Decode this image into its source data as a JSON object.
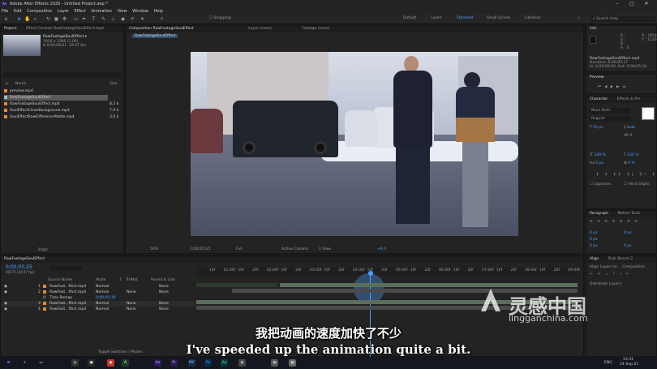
{
  "window": {
    "title": "Adobe After Effects 2020 - Untitled Project.aep *",
    "controls": [
      "–",
      "□",
      "✕"
    ]
  },
  "menu": [
    "File",
    "Edit",
    "Composition",
    "Layer",
    "Effect",
    "Animation",
    "View",
    "Window",
    "Help"
  ],
  "toolbar": {
    "snapping": "Snapping",
    "workspaces": [
      "Default",
      "Learn",
      "Standard",
      "Small Screen",
      "Libraries"
    ],
    "active_workspace": "Standard",
    "more": "»",
    "search_help": "Search Help"
  },
  "project_panel": {
    "tabs": [
      "Project",
      "Effect Controls RawFootageSoulEffect.mp4"
    ],
    "selected_name": "RawFootageSoulEffect ▾",
    "selected_info": [
      "1920 x 1080 (1.00)",
      "Δ 0;00;06;01, 29.97 fps"
    ],
    "search_placeholder": "ρ",
    "col_name": "Name",
    "col_size": "Size",
    "items": [
      {
        "name": "preview.mp4",
        "size": ""
      },
      {
        "name": "RawFootageSoulEffect",
        "size": ""
      },
      {
        "name": "RawFootageSoulEffect.mp4",
        "size": "8.2 k"
      },
      {
        "name": "SoulEffectCleanBackground.mp4",
        "size": "7.9 k"
      },
      {
        "name": "SoulEffectRawDifferenceMatte.mp4",
        "size": "3.0 k"
      }
    ],
    "bpc": "8 bpc"
  },
  "comp_panel": {
    "tabs": [
      "Composition RawFootageSoulEffect",
      "Layer (none)",
      "Footage (none)"
    ],
    "breadcrumb": "RawFootageSoulEffect",
    "footer": [
      "50%",
      "0;00;05;25",
      "Full",
      "Active Camera",
      "1 View",
      "+0.0"
    ]
  },
  "info_panel": {
    "title": "Info",
    "values": [
      "R :",
      "G :",
      "B :",
      "A : 0",
      "X : 1954",
      "Y : 1120"
    ],
    "file": "RawFootageSoulEffect.mp4",
    "lines": [
      "Duration: 0;00;05;17",
      "In: 0;00;00;00, Out: 0;00;05;16"
    ]
  },
  "preview_panel": {
    "title": "Preview"
  },
  "character_panel": {
    "tabs": [
      "Character",
      "Effects & Pre"
    ],
    "font": "Nexa Bold",
    "style": "Regular",
    "size": "55 px",
    "leading": "Auto",
    "tracking": "0",
    "scale_v": "100 %",
    "scale_h": "100 %",
    "baseline": "0 px",
    "tsume": "0 %",
    "ligatures": "Ligatures",
    "hindi": "Hindi Digits"
  },
  "paragraph_panel": {
    "tabs": [
      "Paragraph",
      "Motion Tools"
    ],
    "values": [
      "0 px",
      "0 px",
      "0 px",
      "0 px",
      "0 px"
    ]
  },
  "align_panel": {
    "tabs": [
      "Align",
      "Duik Bassel.2"
    ],
    "align_to": "Align Layers to:",
    "align_target": "Composition",
    "distribute": "Distribute Layers:"
  },
  "timeline": {
    "tab": "RawFootageSoulEffect",
    "timecode": "0;00;05;25",
    "timecode_sub": "00175 (29.97 fps)",
    "columns": [
      "Source Name",
      "Mode",
      "T",
      "TrkMat",
      "Parent & Link"
    ],
    "layers": [
      {
        "num": "1",
        "name": "RawFoot...ffect.mp4",
        "mode": "Normal",
        "trk": "",
        "parent": "None"
      },
      {
        "num": "2",
        "name": "RawFoot...ffect.mp4",
        "mode": "Normal",
        "trk": "None",
        "parent": "None"
      },
      {
        "num": "",
        "name": "Time Remap",
        "mode": "0;00;05;19",
        "trk": "",
        "parent": ""
      },
      {
        "num": "3",
        "name": "RawFoot...ffect.mp4",
        "mode": "Normal",
        "trk": "None",
        "parent": "None"
      },
      {
        "num": "4",
        "name": "RawFoot...ffect.mp4",
        "mode": "Normal",
        "trk": "None",
        "parent": "None"
      }
    ],
    "ruler": [
      "10f",
      "01:00f",
      "10f",
      "20f",
      "02:00f",
      "10f",
      "20f",
      "03:00f",
      "10f",
      "20f",
      "04:00f",
      "10f",
      "20f",
      "05:00f",
      "10f",
      "20f",
      "06:00f",
      "10f",
      "20f",
      "07:00f",
      "10f",
      "20f",
      "08:00f",
      "10f",
      "20f",
      "09:00f"
    ],
    "toggle": "Toggle Switches / Modes"
  },
  "subtitles": {
    "zh": "我把动画的速度加快了不少",
    "en": "I've speeded up the animation quite a bit."
  },
  "watermark": {
    "cn": "灵感中国",
    "url": "lingganchina.com"
  },
  "taskbar": {
    "apps": [
      "Ae",
      "Pr",
      "MC",
      "Ps",
      "Au"
    ],
    "lang": "ENG",
    "time": "13:41",
    "date": "24-Sep-21"
  },
  "colors": {
    "accent": "#4fa0ff",
    "footage_label": "#e58b2a",
    "track_green": "#5b6e5b"
  }
}
